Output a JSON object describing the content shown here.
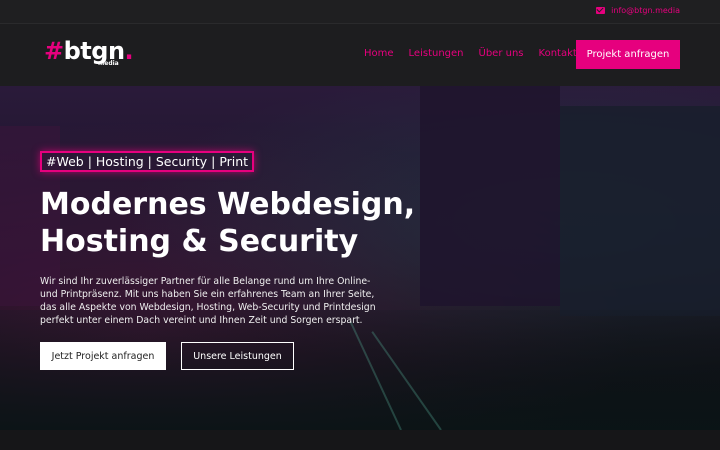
{
  "topbar": {
    "email": "info@btgn.media",
    "icon": "mail-icon"
  },
  "brand": {
    "hash": "#",
    "name": "btgn",
    "dot": ".",
    "sub": "media"
  },
  "nav": {
    "items": [
      "Home",
      "Leistungen",
      "Über uns",
      "Kontakt"
    ],
    "cta": "Projekt anfragen"
  },
  "hero": {
    "tag": "#Web | Hosting | Security | Print",
    "title_line1": "Modernes Webdesign,",
    "title_line2": "Hosting & Security",
    "desc": "Wir sind Ihr zuverlässiger Partner für alle Belange rund um Ihre Online- und Printpräsenz. Mit uns haben Sie ein erfahrenes Team an Ihrer Seite, das alle Aspekte von Webdesign, Hosting, Web-Security und Printdesign perfekt unter einem Dach vereint und Ihnen Zeit und Sorgen erspart.",
    "btn_primary": "Jetzt Projekt anfragen",
    "btn_secondary": "Unsere Leistungen"
  },
  "colors": {
    "accent": "#e6007e",
    "background": "#1d1d1f"
  }
}
